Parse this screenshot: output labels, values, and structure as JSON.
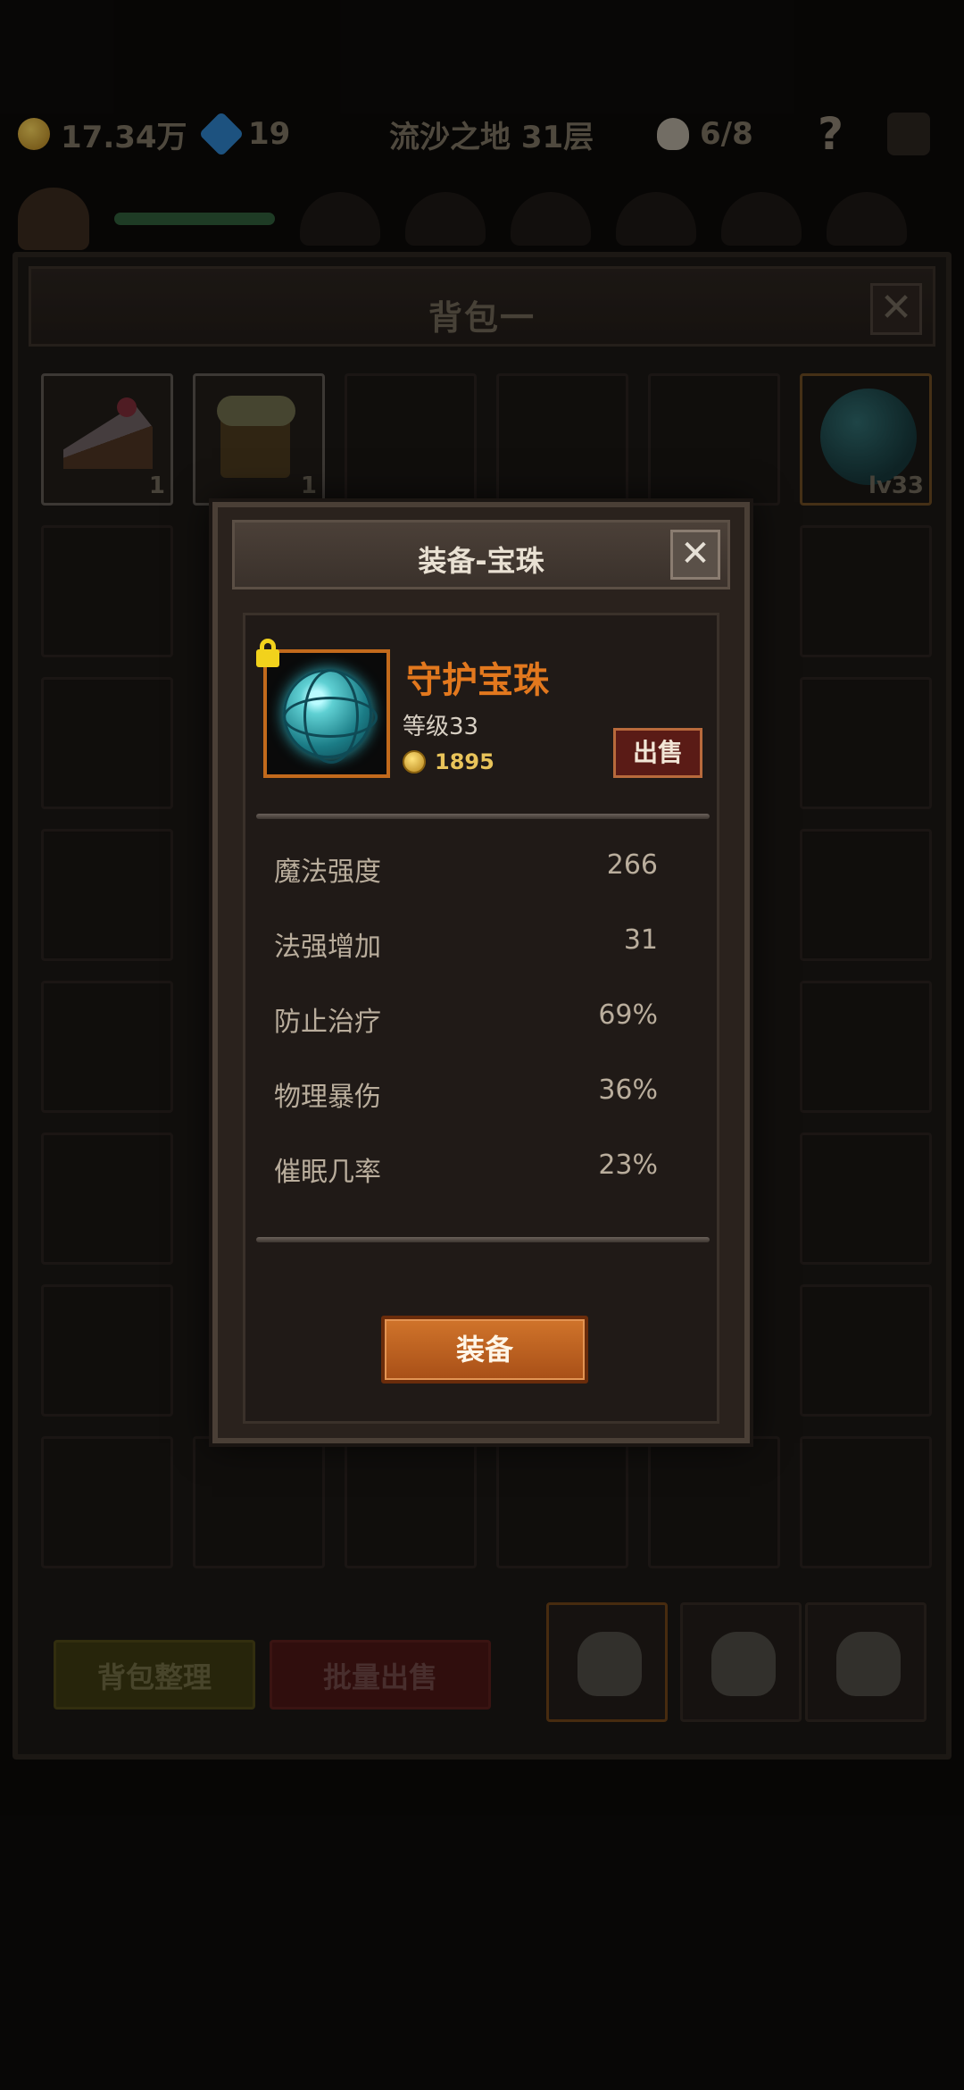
{
  "topbar": {
    "gold": "17.34万",
    "gems": "19",
    "location": "流沙之地 31层",
    "skulls": "6/8",
    "help": "?"
  },
  "bag": {
    "title": "背包一",
    "close": "✕",
    "slot1_count": "1",
    "slot2_count": "1",
    "slot6_level": "lv33",
    "sort_label": "背包整理",
    "bulk_sell_label": "批量出售"
  },
  "modal": {
    "title": "装备-宝珠",
    "close": "✕",
    "item_name": "守护宝珠",
    "item_level": "等级33",
    "price": "1895",
    "sell_label": "出售",
    "equip_label": "装备",
    "stats": [
      {
        "name": "魔法强度",
        "value": "266"
      },
      {
        "name": "法强增加",
        "value": "31"
      },
      {
        "name": "防止治疗",
        "value": "69%"
      },
      {
        "name": "物理暴伤",
        "value": "36%"
      },
      {
        "name": "催眠几率",
        "value": "23%"
      }
    ]
  },
  "colors": {
    "accent_orange": "#e2781e",
    "gold_text": "#e9c45a",
    "equip_button": "#c0621f",
    "sell_button": "#5a1b16"
  },
  "icons": {
    "lock": "lock-icon",
    "coin": "coin-icon",
    "item": "orb-icon"
  }
}
